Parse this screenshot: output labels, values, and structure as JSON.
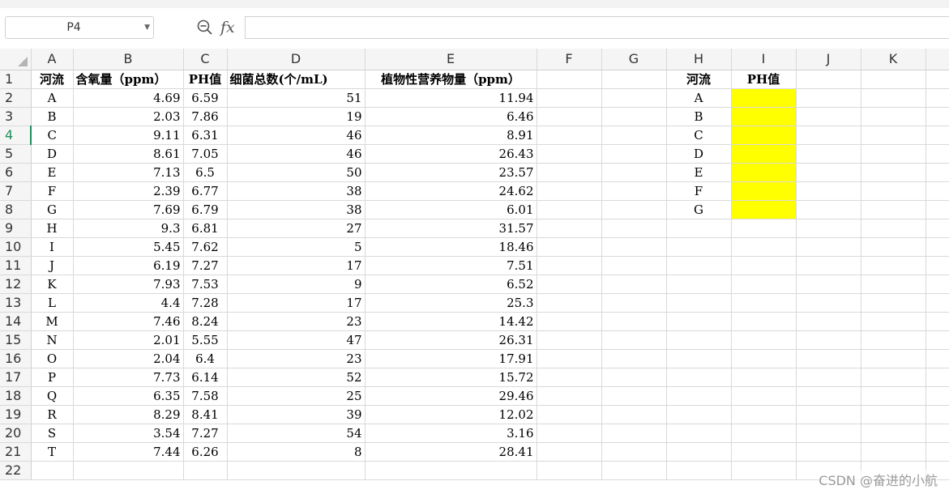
{
  "name_box": {
    "value": "P4"
  },
  "formula_bar": {
    "fx_label": "fx",
    "value": ""
  },
  "columns": [
    "A",
    "B",
    "C",
    "D",
    "E",
    "F",
    "G",
    "H",
    "I",
    "J",
    "K"
  ],
  "headers": {
    "river": "河流",
    "oxygen": "含氧量（ppm）",
    "ph": "PH值",
    "bacteria": "细菌总数(个/mL)",
    "nutrients": "植物性营养物量（ppm）",
    "lookup_river": "河流",
    "lookup_ph": "PH值"
  },
  "rows": [
    {
      "river": "A",
      "oxygen": "4.69",
      "ph": "6.59",
      "bacteria": "51",
      "nutrients": "11.94",
      "lookup": "A"
    },
    {
      "river": "B",
      "oxygen": "2.03",
      "ph": "7.86",
      "bacteria": "19",
      "nutrients": "6.46",
      "lookup": "B"
    },
    {
      "river": "C",
      "oxygen": "9.11",
      "ph": "6.31",
      "bacteria": "46",
      "nutrients": "8.91",
      "lookup": "C"
    },
    {
      "river": "D",
      "oxygen": "8.61",
      "ph": "7.05",
      "bacteria": "46",
      "nutrients": "26.43",
      "lookup": "D"
    },
    {
      "river": "E",
      "oxygen": "7.13",
      "ph": "6.5",
      "bacteria": "50",
      "nutrients": "23.57",
      "lookup": "E"
    },
    {
      "river": "F",
      "oxygen": "2.39",
      "ph": "6.77",
      "bacteria": "38",
      "nutrients": "24.62",
      "lookup": "F"
    },
    {
      "river": "G",
      "oxygen": "7.69",
      "ph": "6.79",
      "bacteria": "38",
      "nutrients": "6.01",
      "lookup": "G"
    },
    {
      "river": "H",
      "oxygen": "9.3",
      "ph": "6.81",
      "bacteria": "27",
      "nutrients": "31.57",
      "lookup": ""
    },
    {
      "river": "I",
      "oxygen": "5.45",
      "ph": "7.62",
      "bacteria": "5",
      "nutrients": "18.46",
      "lookup": ""
    },
    {
      "river": "J",
      "oxygen": "6.19",
      "ph": "7.27",
      "bacteria": "17",
      "nutrients": "7.51",
      "lookup": ""
    },
    {
      "river": "K",
      "oxygen": "7.93",
      "ph": "7.53",
      "bacteria": "9",
      "nutrients": "6.52",
      "lookup": ""
    },
    {
      "river": "L",
      "oxygen": "4.4",
      "ph": "7.28",
      "bacteria": "17",
      "nutrients": "25.3",
      "lookup": ""
    },
    {
      "river": "M",
      "oxygen": "7.46",
      "ph": "8.24",
      "bacteria": "23",
      "nutrients": "14.42",
      "lookup": ""
    },
    {
      "river": "N",
      "oxygen": "2.01",
      "ph": "5.55",
      "bacteria": "47",
      "nutrients": "26.31",
      "lookup": ""
    },
    {
      "river": "O",
      "oxygen": "2.04",
      "ph": "6.4",
      "bacteria": "23",
      "nutrients": "17.91",
      "lookup": ""
    },
    {
      "river": "P",
      "oxygen": "7.73",
      "ph": "6.14",
      "bacteria": "52",
      "nutrients": "15.72",
      "lookup": ""
    },
    {
      "river": "Q",
      "oxygen": "6.35",
      "ph": "7.58",
      "bacteria": "25",
      "nutrients": "29.46",
      "lookup": ""
    },
    {
      "river": "R",
      "oxygen": "8.29",
      "ph": "8.41",
      "bacteria": "39",
      "nutrients": "12.02",
      "lookup": ""
    },
    {
      "river": "S",
      "oxygen": "3.54",
      "ph": "7.27",
      "bacteria": "54",
      "nutrients": "3.16",
      "lookup": ""
    },
    {
      "river": "T",
      "oxygen": "7.44",
      "ph": "6.26",
      "bacteria": "8",
      "nutrients": "28.41",
      "lookup": ""
    }
  ],
  "highlight_color": "#ffff00",
  "active_row_color": "#1e8e5a",
  "watermark": "CSDN @奋进的小航"
}
